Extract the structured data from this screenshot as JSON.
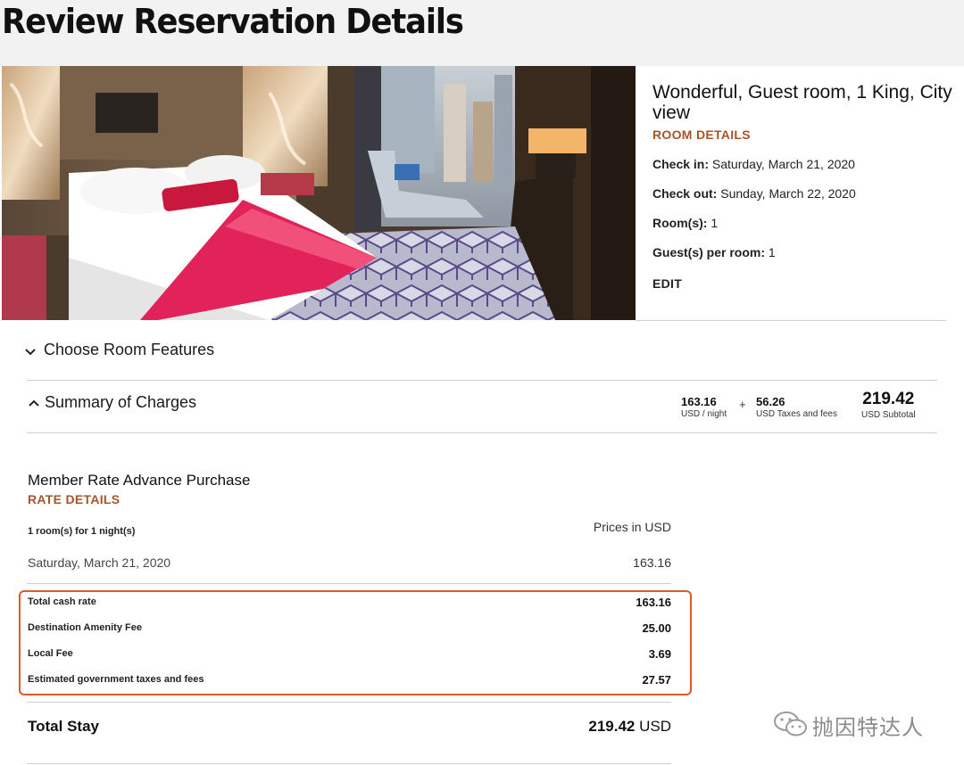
{
  "page": {
    "title": "Review Reservation Details"
  },
  "room": {
    "name": "Wonderful, Guest room, 1 King, City view",
    "details_link": "ROOM DETAILS",
    "check_in_label": "Check in:",
    "check_in_value": "Saturday, March 21, 2020",
    "check_out_label": "Check out:",
    "check_out_value": "Sunday, March 22, 2020",
    "rooms_label": "Room(s):",
    "rooms_value": "1",
    "guests_label": "Guest(s) per room:",
    "guests_value": "1",
    "edit_link": "EDIT"
  },
  "features": {
    "title": "Choose Room Features"
  },
  "charges": {
    "title": "Summary of Charges",
    "nightly_value": "163.16",
    "nightly_label": "USD / night",
    "plus": "+",
    "taxes_value": "56.26",
    "taxes_label": "USD Taxes and fees",
    "subtotal_value": "219.42",
    "subtotal_label": "USD Subtotal"
  },
  "rate": {
    "name": "Member Rate Advance Purchase",
    "details_link": "RATE DETAILS",
    "rooms_nights": "1 room(s) for 1 night(s)",
    "prices_in": "Prices in USD",
    "night_date": "Saturday, March 21, 2020",
    "night_price": "163.16"
  },
  "fees": [
    {
      "label": "Total cash rate",
      "value": "163.16"
    },
    {
      "label": "Destination Amenity Fee",
      "value": "25.00"
    },
    {
      "label": "Local Fee",
      "value": "3.69"
    },
    {
      "label": "Estimated government taxes and fees",
      "value": "27.57"
    }
  ],
  "total": {
    "label": "Total Stay",
    "value": "219.42",
    "currency": "USD"
  },
  "watermark": {
    "text": "抛因特达人"
  },
  "colors": {
    "accent": "#a6552b",
    "highlight_border": "#dd5a2a"
  }
}
